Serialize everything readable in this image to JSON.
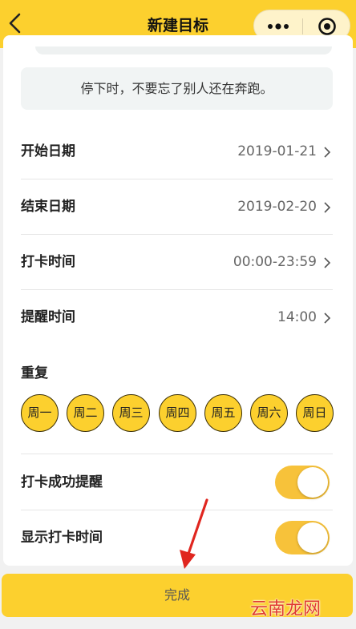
{
  "nav": {
    "title": "新建目标"
  },
  "motto": "停下时，不要忘了别人还在奔跑。",
  "rows": [
    {
      "label": "开始日期",
      "value": "2019-01-21"
    },
    {
      "label": "结束日期",
      "value": "2019-02-20"
    },
    {
      "label": "打卡时间",
      "value": "00:00-23:59"
    },
    {
      "label": "提醒时间",
      "value": "14:00"
    }
  ],
  "repeat": {
    "label": "重复",
    "days": [
      "周一",
      "周二",
      "周三",
      "周四",
      "周五",
      "周六",
      "周日"
    ]
  },
  "toggles": [
    {
      "label": "打卡成功提醒",
      "on": true
    },
    {
      "label": "显示打卡时间",
      "on": true
    }
  ],
  "done_label": "完成",
  "watermark": "云南龙网",
  "colors": {
    "accent": "#fcd02e",
    "switch_on": "#f7c23a",
    "annotation_arrow": "#e0261f"
  }
}
